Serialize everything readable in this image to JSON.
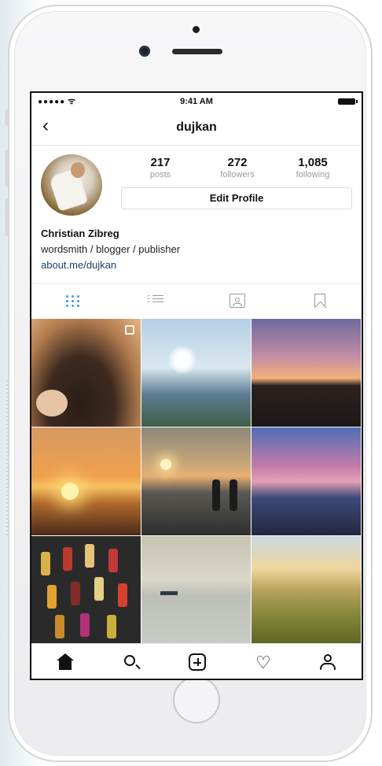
{
  "status": {
    "time": "9:41 AM",
    "signal": "●●●●●",
    "wifi": "ᯤ"
  },
  "nav": {
    "username": "dujkan",
    "back_icon": "chevron-left-icon"
  },
  "profile": {
    "posts": "217",
    "posts_label": "posts",
    "followers": "272",
    "followers_label": "followers",
    "following": "1,085",
    "following_label": "following",
    "edit_label": "Edit Profile",
    "name": "Christian Zibreg",
    "bio": "wordsmith / blogger / publisher",
    "link": "about.me/dujkan"
  },
  "tabs": [
    {
      "icon": "grid-icon",
      "active": true
    },
    {
      "icon": "list-icon"
    },
    {
      "icon": "tagged-icon"
    },
    {
      "icon": "bookmark-icon"
    }
  ],
  "bottom_nav": [
    "home-icon",
    "search-icon",
    "add-icon",
    "heart-icon",
    "profile-icon"
  ],
  "colors": {
    "active_tab": "#3897f0",
    "link": "#1f3e6b"
  }
}
